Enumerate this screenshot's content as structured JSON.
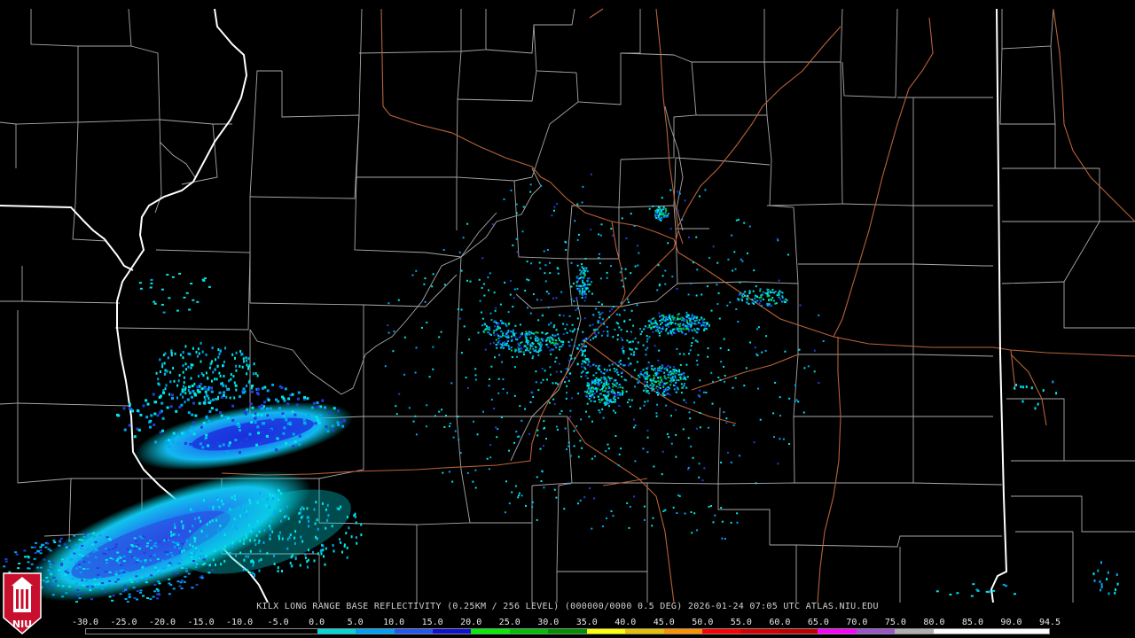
{
  "caption": "KILX LONG RANGE BASE REFLECTIVITY (0.25KM / 256 LEVEL) (000000/0000 0.5 DEG) 2026-01-24 07:05 UTC  ATLAS.NIU.EDU",
  "logo_text": "NIU",
  "scale": {
    "ticks": [
      "-30.0",
      "-25.0",
      "-20.0",
      "-15.0",
      "-10.0",
      "-5.0",
      "0.0",
      "5.0",
      "10.0",
      "15.0",
      "20.0",
      "25.0",
      "30.0",
      "35.0",
      "40.0",
      "45.0",
      "50.0",
      "55.0",
      "60.0",
      "65.0",
      "70.0",
      "75.0",
      "80.0",
      "85.0",
      "90.0",
      "94.5"
    ],
    "colors": [
      "#000000",
      "#000000",
      "#000000",
      "#000000",
      "#000000",
      "#000000",
      "#00d8d8",
      "#00a0f6",
      "#2058f0",
      "#1010d0",
      "#00f000",
      "#00c000",
      "#009000",
      "#ffff00",
      "#e7c000",
      "#ff9000",
      "#ff0000",
      "#d60000",
      "#c00000",
      "#ff00ff",
      "#9955c9",
      "#b0b0b0",
      "#ffffff",
      "#ffffff",
      "#ffffff"
    ]
  },
  "colors": {
    "background": "#000000",
    "county_border": "#a8a8a8",
    "state_border": "#ffffff",
    "highway": "#b8623a",
    "echo_light": "#00e8e8",
    "echo_medium": "#00a8f0",
    "echo_dark": "#2040e0",
    "echo_green": "#00d040"
  }
}
